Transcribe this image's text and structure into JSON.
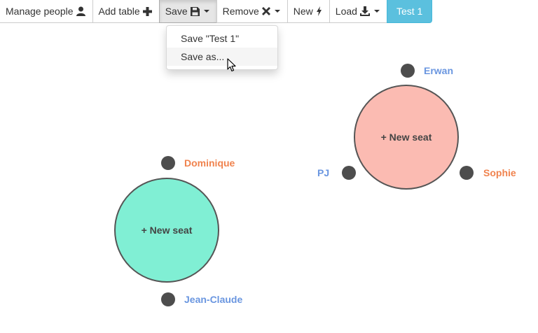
{
  "toolbar": {
    "manage_people": "Manage people",
    "add_table": "Add table",
    "save": "Save",
    "remove": "Remove",
    "new": "New",
    "load": "Load",
    "current_plan": "Test 1"
  },
  "save_menu": {
    "items": [
      "Save \"Test 1\"",
      "Save as..."
    ]
  },
  "tables": [
    {
      "label": "+ New seat",
      "color": "#fbbbb2",
      "seats": [
        "Erwan",
        "PJ",
        "Sophie"
      ]
    },
    {
      "label": "+ New seat",
      "color": "#80efd4",
      "seats": [
        "Dominique",
        "Jean-Claude"
      ]
    }
  ],
  "colors": {
    "seat_blue": "#6a96e0",
    "seat_orange": "#f0834e",
    "accent": "#5bc0de"
  },
  "icons": [
    "user-icon",
    "plus-icon",
    "floppy-disk-icon",
    "times-icon",
    "bolt-icon",
    "download-icon",
    "mouse-pointer-icon"
  ]
}
